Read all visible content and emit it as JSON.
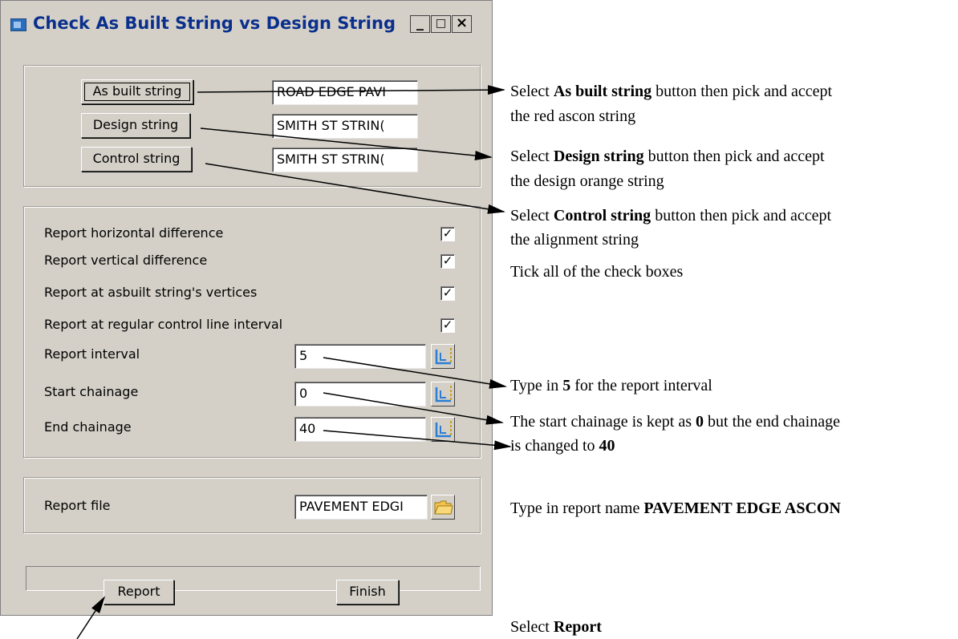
{
  "window": {
    "title": "Check As Built String vs Design String",
    "controls": [
      "_",
      "□",
      "×"
    ]
  },
  "strings": {
    "as_built_label": "As built string",
    "as_built_value": "ROAD EDGE PAVI",
    "design_label": "Design string",
    "design_value": "SMITH ST STRIN(",
    "control_label": "Control string",
    "control_value": "SMITH ST STRIN("
  },
  "options": {
    "items": [
      {
        "label": "Report horizontal difference",
        "checked": true
      },
      {
        "label": "Report vertical difference",
        "checked": true
      },
      {
        "label": "Report at asbuilt string's vertices",
        "checked": true
      },
      {
        "label": "Report at regular control line interval",
        "checked": true
      }
    ],
    "interval_label": "Report interval",
    "interval_value": "5",
    "start_label": "Start chainage",
    "start_value": "0",
    "end_label": "End chainage",
    "end_value": "40"
  },
  "report": {
    "file_label": "Report file",
    "file_value": "PAVEMENT EDGI",
    "report_button": "Report",
    "finish_button": "Finish",
    "status_text": ""
  },
  "notes": {
    "n1_pre": "Select ",
    "n1_bold": "As built string",
    "n1_post": " button then pick and accept",
    "n1_line2": "the red ascon string",
    "n2_pre": "Select ",
    "n2_bold": "Design string",
    "n2_post": " button then pick and accept",
    "n2_line2": "the design orange string",
    "n3_pre": "Select ",
    "n3_bold": "Control string",
    "n3_post": " button then pick and accept",
    "n3_line2": "the alignment string",
    "n4": "Tick all of the check boxes",
    "n5_pre": "Type in ",
    "n5_bold": "5",
    "n5_post": " for the report interval",
    "n6_pre": "The start chainage is kept as ",
    "n6_bold": "0",
    "n6_post": " but the end chainage",
    "n6_line2_pre": "is changed to ",
    "n6_line2_bold": "40",
    "n7_pre": "Type in report name ",
    "n7_bold": "PAVEMENT EDGE ASCON",
    "n8_pre": "Select ",
    "n8_bold": "Report"
  },
  "icons": {
    "app": "app-window-icon",
    "pick": "pick-chainage-icon",
    "folder": "folder-icon"
  },
  "colors": {
    "dialog_bg": "#d4d0c8",
    "title_text": "#0a2f8c",
    "pick_icon": "#2a7fd4",
    "folder_icon": "#f2c14e"
  }
}
